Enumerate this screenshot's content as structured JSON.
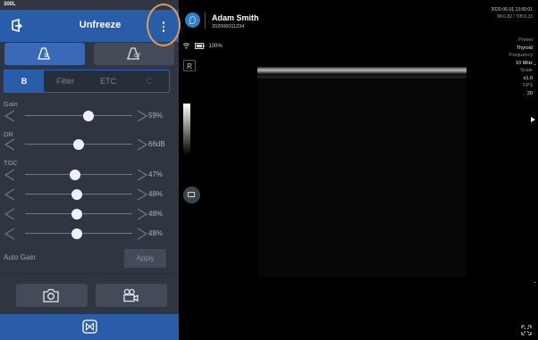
{
  "panel": {
    "probe_label": "300L",
    "header_title": "Unfreeze",
    "tabs": [
      {
        "label": "B",
        "active": true
      },
      {
        "label": "Filter",
        "active": false
      },
      {
        "label": "ETC",
        "active": false
      },
      {
        "label": "C",
        "active": false
      }
    ],
    "gain": {
      "label": "Gain",
      "value": "59%",
      "level": 0.59
    },
    "dr": {
      "label": "DR",
      "value": "66dB",
      "level": 0.5
    },
    "tgc": {
      "label": "TGC",
      "rows": [
        {
          "value": "47%",
          "level": 0.47
        },
        {
          "value": "48%",
          "level": 0.48
        },
        {
          "value": "48%",
          "level": 0.48
        },
        {
          "value": "48%",
          "level": 0.48
        }
      ]
    },
    "auto_gain_label": "Auto Gain",
    "apply_label": "Apply",
    "icons": {
      "back": "back-icon",
      "menu": "kebab-menu-icon",
      "mode_b": "b-mode-probe-icon",
      "mode_cf": "color-flow-probe-icon",
      "camera": "camera-icon",
      "video": "video-camera-icon",
      "freeze": "freeze-icon"
    },
    "colors": {
      "accent": "#2a5da9",
      "panel_bg": "#2f3642",
      "highlight": "#e49a52"
    }
  },
  "viewer": {
    "patient_name": "Adam Smith",
    "patient_id": "202006011234",
    "battery": "100%",
    "orientation_marker": "R",
    "datetime": "2020-06-01 13:00:01",
    "mi_tib": "MI:0.82 / TIB:0.33",
    "params": [
      {
        "key": "Preset",
        "value": "Thyroid"
      },
      {
        "key": "Frequency",
        "value": "10 MHz"
      },
      {
        "key": "Scale",
        "value": "x1.0"
      },
      {
        "key": "FPS",
        "value": "20"
      }
    ],
    "icons": {
      "logo": "app-logo-icon",
      "wifi": "wifi-icon",
      "battery": "battery-icon",
      "grayscale": "grayscale-bar",
      "image_toggle": "image-toggle-icon",
      "fullscreen": "fullscreen-icon",
      "expand_arrow": "expand-arrow-icon"
    }
  }
}
